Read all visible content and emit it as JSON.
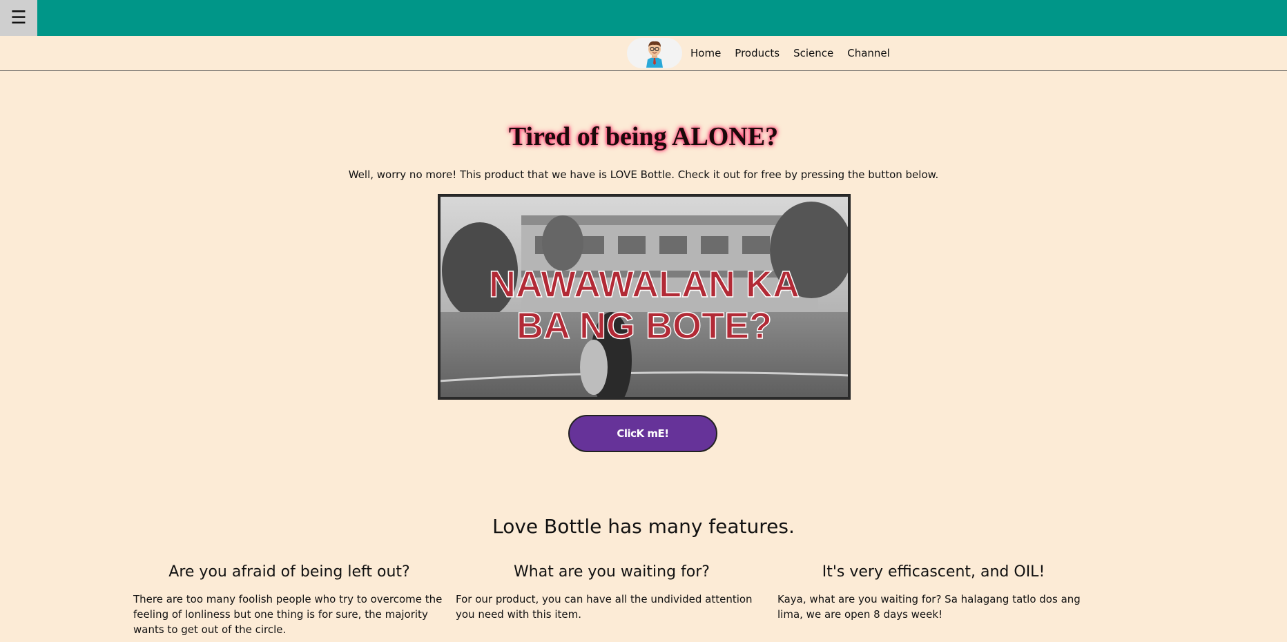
{
  "topbar": {
    "menu_icon": "hamburger-icon",
    "menu_glyph": "☰",
    "color": "#009688"
  },
  "nav": {
    "logo_icon": "avatar-logo-icon",
    "links": [
      {
        "label": "Home"
      },
      {
        "label": "Products"
      },
      {
        "label": "Science"
      },
      {
        "label": "Channel"
      }
    ]
  },
  "hero": {
    "title": "Tired of being ALONE?",
    "text": "Well, worry no more! This product that we have is LOVE Bottle. Check it out for free by pressing the button below.",
    "video_caption_line1": "NAWAWALAN KA",
    "video_caption_line2": "BA NG BOTE?",
    "button_label": "ClicK mE!",
    "button_color": "#663399"
  },
  "features": {
    "title": "Love Bottle has many features.",
    "items": [
      {
        "heading": "Are you afraid of being left out?",
        "body": "There are too many foolish people who try to overcome the feeling of lonliness but one thing is for sure, the majority wants to get out of the circle."
      },
      {
        "heading": "What are you waiting for?",
        "body": "For our product, you can have all the undivided attention you need with this item."
      },
      {
        "heading": "It's very efficascent, and OIL!",
        "body": "Kaya, what are you waiting for? Sa halagang tatlo dos ang lima, we are open 8 days week!"
      }
    ]
  },
  "colors": {
    "background": "#fcebd6",
    "accent": "#009688",
    "button": "#663399",
    "glow": "#ff2d6a"
  }
}
